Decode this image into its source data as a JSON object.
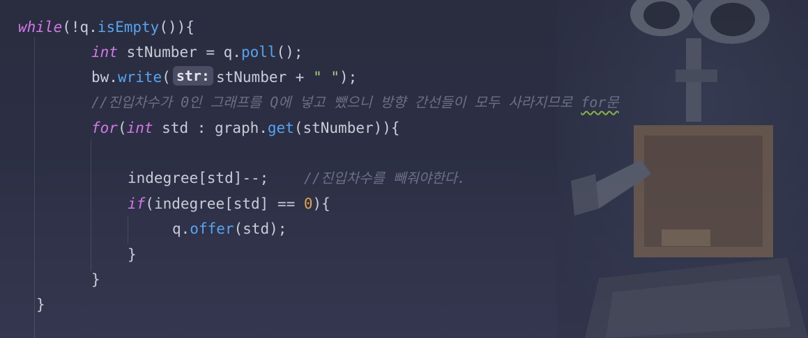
{
  "code": {
    "l1": {
      "kw": "while",
      "rest1": "(!q.",
      "fn": "isEmpty",
      "rest2": "()){"
    },
    "l2": {
      "kw": "int",
      "rest1": " stNumber = q.",
      "fn": "poll",
      "rest2": "();"
    },
    "l3": {
      "pre": "bw.",
      "fn": "write",
      "open": "(",
      "hint": "str:",
      "mid": "stNumber + ",
      "str": "\" \"",
      "close": ");"
    },
    "l4": {
      "comment": "//진입차수가 0인 그래프를 Q에 넣고 뺐으니 방향 간선들이 모두 사라지므로 ",
      "squiggle": "for문"
    },
    "l5": {
      "kw": "for",
      "rest1": "(",
      "kw2": "int",
      "rest2": " std : graph.",
      "fn": "get",
      "rest3": "(stNumber)){"
    },
    "l7": {
      "code": "indegree[std]--;    ",
      "comment": "//진입차수를 빼줘야한다."
    },
    "l8": {
      "kw": "if",
      "rest1": "(indegree[std] == ",
      "num": "0",
      "rest2": "){"
    },
    "l9": {
      "pre": "q.",
      "fn": "offer",
      "rest": "(std);"
    },
    "l10": {
      "brace": "}"
    },
    "l11": {
      "brace": "}"
    },
    "l12": {
      "brace": "}"
    }
  }
}
